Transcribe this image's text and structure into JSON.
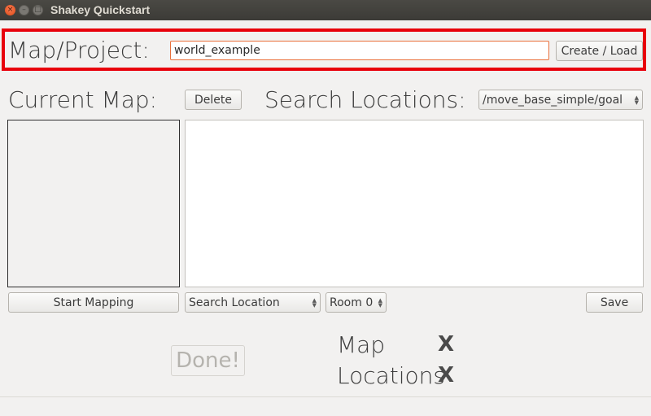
{
  "window": {
    "title": "Shakey Quickstart",
    "close_glyph": "×",
    "min_glyph": "–",
    "max_glyph": "□"
  },
  "project": {
    "label": "Map/Project:",
    "input_value": "world_example",
    "create_load_label": "Create / Load"
  },
  "current_map": {
    "label": "Current Map:",
    "delete_label": "Delete",
    "start_mapping_label": "Start Mapping"
  },
  "search": {
    "label": "Search Locations:",
    "topic_selected": "/move_base_simple/goal",
    "location_type_selected": "Search Location",
    "room_selected": "Room 0",
    "save_label": "Save"
  },
  "status": {
    "done_label": "Done!",
    "map_label": "Map",
    "map_state": "X",
    "locations_label": "Locations",
    "locations_state": "X"
  },
  "colors": {
    "highlight": "#e8000b",
    "input_focus_border": "#e9703c",
    "close_button": "#df4a16"
  }
}
